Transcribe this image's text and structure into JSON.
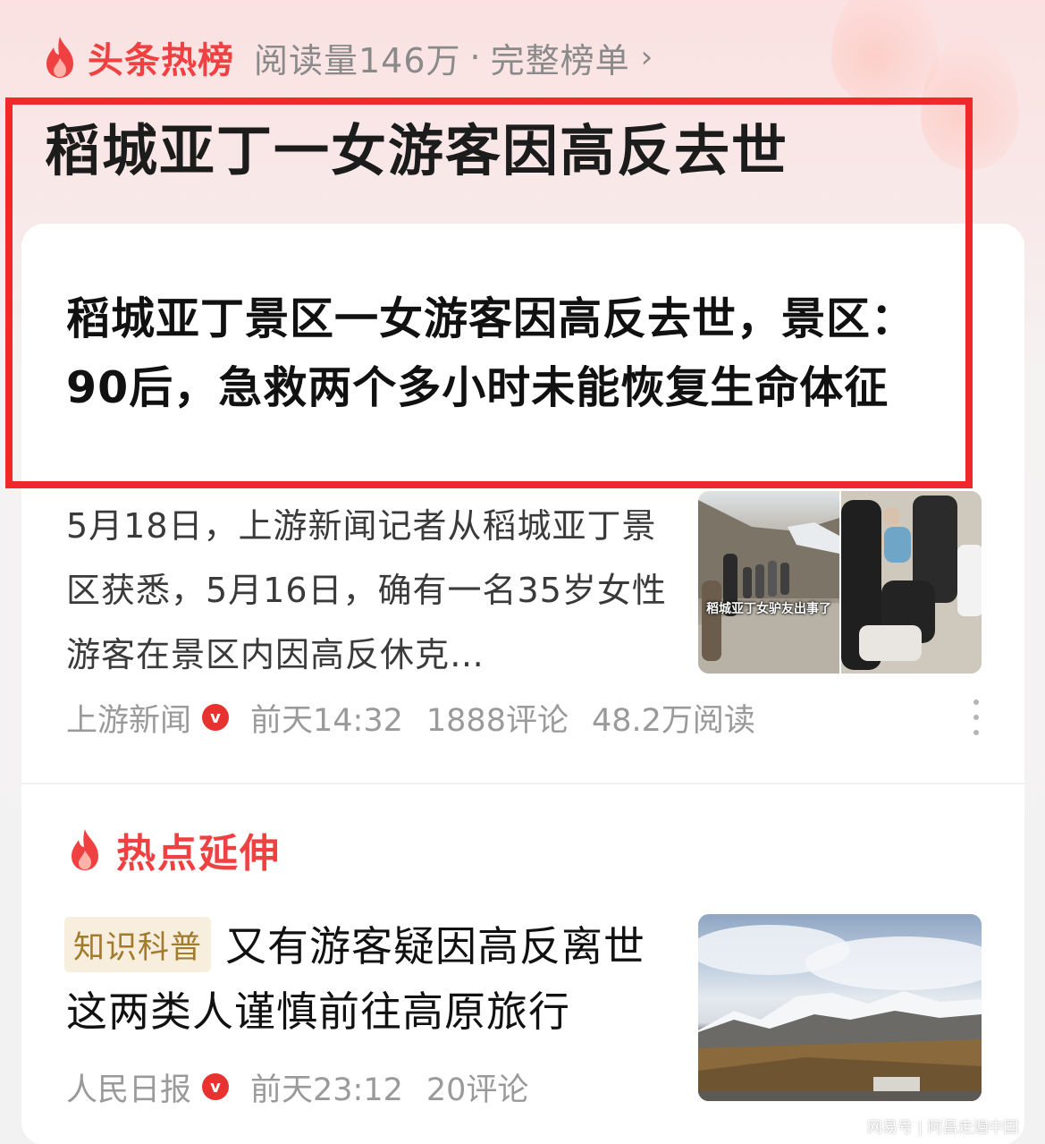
{
  "header": {
    "section_title": "头条热榜",
    "read_count": "阅读量146万",
    "separator": "·",
    "full_list": "完整榜单",
    "chevron": "›",
    "icon": "flame-icon"
  },
  "topic": {
    "headline": "稻城亚丁一女游客因高反去世"
  },
  "article1": {
    "title": "稻城亚丁景区一女游客因高反去世，景区：90后，急救两个多小时未能恢复生命体征",
    "summary": "5月18日，上游新闻记者从稻城亚丁景区获悉，5月16日，确有一名35岁女性游客在景区内因高反休克…",
    "thumbnail_caption": "稻城亚丁女驴友出事了",
    "source": "上游新闻",
    "verified_badge": "v",
    "time": "前天14:32",
    "comments": "1888评论",
    "reads": "48.2万阅读"
  },
  "hot_extension": {
    "label": "热点延伸",
    "icon": "flame-icon"
  },
  "article2": {
    "tag": "知识科普",
    "title_line1": "又有游客疑因高反离世",
    "title_line2": "这两类人谨慎前往高原旅行",
    "source": "人民日报",
    "verified_badge": "v",
    "time": "前天23:12",
    "comments": "20评论"
  },
  "watermark": "网易号 | 阿昌走遍中国",
  "colors": {
    "accent_red": "#f04142",
    "highlight_box": "#f0282c",
    "tag_bg": "#f7eedd",
    "tag_text": "#a47a2d"
  }
}
